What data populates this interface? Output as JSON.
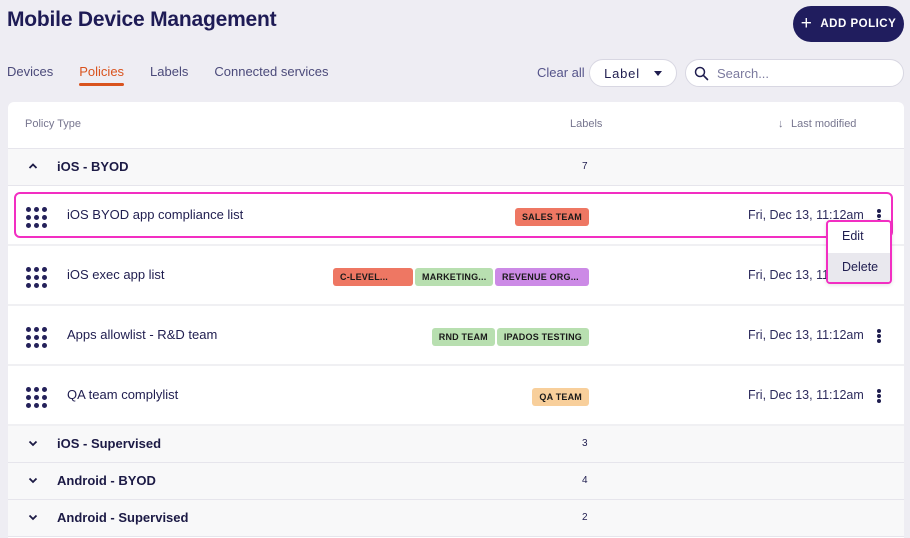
{
  "header": {
    "title": "Mobile Device Management",
    "add_button_label": "ADD POLICY",
    "add_button_icon": "plus-icon"
  },
  "tabs": [
    {
      "label": "Devices",
      "active": false
    },
    {
      "label": "Policies",
      "active": true
    },
    {
      "label": "Labels",
      "active": false
    },
    {
      "label": "Connected services",
      "active": false
    }
  ],
  "filters": {
    "clear_all": "Clear all",
    "label_select": "Label",
    "search_placeholder": "Search...",
    "search_value": ""
  },
  "table": {
    "columns": {
      "policy_type": "Policy Type",
      "labels": "Labels",
      "last_modified": "Last modified",
      "sort_icon": "arrow-down-icon"
    },
    "groups": [
      {
        "name": "iOS - BYOD",
        "count": "7",
        "expanded": true,
        "rows": [
          {
            "name": "iOS BYOD app compliance list",
            "labels": [
              {
                "text": "SALES TEAM",
                "color": "#ee7763"
              }
            ],
            "date": "Fri, Dec 13, 11:12am"
          },
          {
            "name": "iOS exec app list",
            "labels": [
              {
                "text": "C-LEVEL...",
                "color": "#ee7763"
              },
              {
                "text": "MARKETING...",
                "color": "#b8dfb0"
              },
              {
                "text": "REVENUE ORG...",
                "color": "#cc8ae6"
              }
            ],
            "date": "Fri, Dec 13, 11:12am"
          },
          {
            "name": "Apps allowlist - R&D team",
            "labels": [
              {
                "text": "RND TEAM",
                "color": "#b8dfb0"
              },
              {
                "text": "IPADOS TESTING",
                "color": "#b8dfb0"
              }
            ],
            "date": "Fri, Dec 13, 11:12am"
          },
          {
            "name": "QA team complylist",
            "labels": [
              {
                "text": "QA TEAM",
                "color": "#f8cf9b"
              }
            ],
            "date": "Fri, Dec 13, 11:12am"
          }
        ]
      },
      {
        "name": "iOS - Supervised",
        "count": "3",
        "expanded": false
      },
      {
        "name": "Android - BYOD",
        "count": "4",
        "expanded": false
      },
      {
        "name": "Android - Supervised",
        "count": "2",
        "expanded": false
      }
    ]
  },
  "context_menu": {
    "items": [
      {
        "label": "Edit"
      },
      {
        "label": "Delete",
        "hovered": true
      }
    ]
  },
  "colors": {
    "brand": "#201d5e",
    "accent": "#d9531e",
    "highlight": "#f22ec2"
  }
}
